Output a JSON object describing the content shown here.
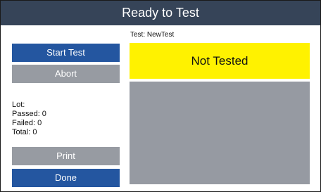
{
  "title": "Ready to Test",
  "buttons": {
    "start_test": "Start Test",
    "abort": "Abort",
    "print": "Print",
    "done": "Done"
  },
  "stats": {
    "lot": "Lot:",
    "passed": "Passed: 0",
    "failed": "Failed: 0",
    "total": "Total: 0"
  },
  "test_name": "Test: NewTest",
  "status": "Not Tested",
  "colors": {
    "titlebar": "#364458",
    "primary_button": "#2456a0",
    "disabled_button": "#979ba2",
    "status_untested": "#fff200",
    "result_area": "#969aa2"
  }
}
